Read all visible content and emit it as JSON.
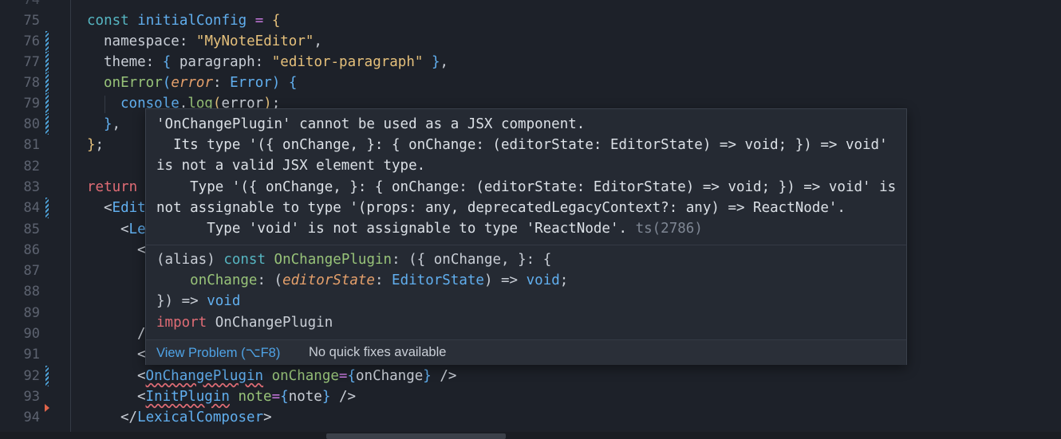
{
  "editor": {
    "lines": [
      {
        "n": "75"
      },
      {
        "n": "76"
      },
      {
        "n": "77"
      },
      {
        "n": "78"
      },
      {
        "n": "79"
      },
      {
        "n": "80"
      },
      {
        "n": "81"
      },
      {
        "n": "82"
      },
      {
        "n": "83"
      },
      {
        "n": "84"
      },
      {
        "n": "85"
      },
      {
        "n": "86"
      },
      {
        "n": "87"
      },
      {
        "n": "88"
      },
      {
        "n": "89"
      },
      {
        "n": "90"
      },
      {
        "n": "91"
      },
      {
        "n": "92"
      },
      {
        "n": "93"
      },
      {
        "n": "94"
      }
    ],
    "code": {
      "l75": {
        "kw": "const",
        "name": "initialConfig",
        "op": "=",
        "brace": "{"
      },
      "l76": {
        "key": "namespace:",
        "val": "\"MyNoteEditor\"",
        "tail": ","
      },
      "l77": {
        "key": "theme:",
        "open": "{",
        "inner_key": "paragraph:",
        "val": "\"editor-paragraph\"",
        "close": "}",
        "tail": ","
      },
      "l78": {
        "fn": "onError",
        "p_open": "(",
        "param": "error",
        "colon": ":",
        "type": "Error",
        "p_close": ")",
        "brace": "{"
      },
      "l79": {
        "obj": "console",
        "dot": ".",
        "fn": "log",
        "open": "(",
        "arg": "error",
        "close": ")",
        "tail": ";"
      },
      "l80": {
        "brace": "}",
        "tail": ","
      },
      "l81": {
        "brace": "}",
        "tail": ";"
      },
      "l83": {
        "kw": "return"
      },
      "l84": {
        "lt": "<",
        "tag": "Edit"
      },
      "l85": {
        "lt": "<",
        "tag": "Le"
      },
      "l86": {
        "lt": "<"
      },
      "l90": {
        "lt": "/"
      },
      "l91": {
        "lt": "<"
      },
      "l92": {
        "lt": "<",
        "tag": "OnChangePlugin",
        "attr": "onChange",
        "eq": "=",
        "open": "{",
        "val": "onChange",
        "close": "}",
        "end": " />"
      },
      "l93": {
        "lt": "<",
        "tag": "InitPlugin",
        "attr": "note",
        "eq": "=",
        "open": "{",
        "val": "note",
        "close": "}",
        "end": " />"
      },
      "l94": {
        "lt": "</",
        "tag": "LexicalComposer",
        "gt": ">"
      }
    }
  },
  "hover": {
    "error_lines": [
      "'OnChangePlugin' cannot be used as a JSX component.",
      "  Its type '({ onChange, }: { onChange: (editorState: EditorState) => void; }) => void'",
      "is not a valid JSX element type.",
      "    Type '({ onChange, }: { onChange: (editorState: EditorState) => void; }) => void' is",
      "not assignable to type '(props: any, deprecatedLegacyContext?: any) => ReactNode'.",
      "      Type 'void' is not assignable to type 'ReactNode'."
    ],
    "error_code": "ts(2786)",
    "signature": {
      "alias": "(alias)",
      "kw": "const",
      "name": "OnChangePlugin",
      "rest1": ": ({ onChange, }: {",
      "indent": "    ",
      "prop": "onChange",
      "colon": ": (",
      "param": "editorState",
      "colon2": ": ",
      "type": "EditorState",
      "arrow_close": ") => ",
      "void": "void",
      "semi": ";",
      "close_line": "}) => ",
      "void2": "void",
      "import_kw": "import",
      "import_name": " OnChangePlugin"
    },
    "actions": {
      "view_problem": "View Problem (⌥F8)",
      "no_fixes": "No quick fixes available"
    }
  },
  "colors": {
    "background": "#1d2129",
    "hover_bg": "#252a33",
    "link": "#4fa3e6",
    "error_squiggle": "#e06c75"
  }
}
